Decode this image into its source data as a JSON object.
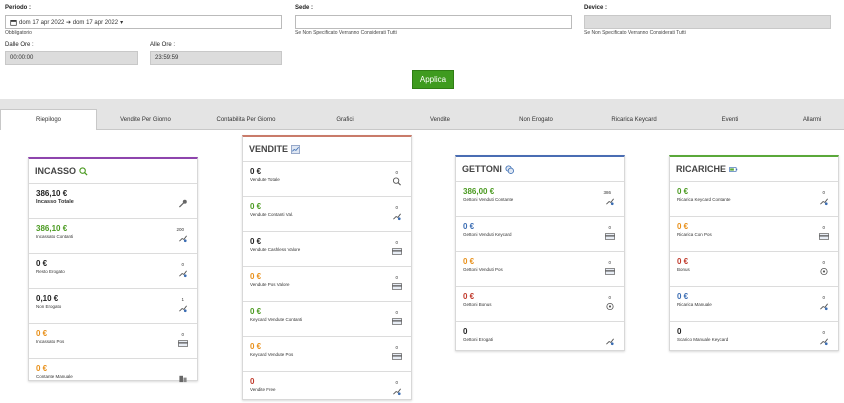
{
  "filters": {
    "period_label": "Periodo :",
    "period_value": "dom 17 apr 2022 ➔ dom 17 apr 2022",
    "period_required": "Obbligatorio",
    "sede_label": "Sede :",
    "sede_hint": "Se Non Specificato Verranno Considerati Tutti",
    "device_label": "Device :",
    "device_hint": "Se Non Specificato Verranno Considerati Tutti",
    "from_label": "Dalle Ore :",
    "from_value": "00:00:00",
    "to_label": "Alle Ore :",
    "to_value": "23:59:59",
    "apply_label": "Applica"
  },
  "tabs": [
    "Riepilogo",
    "Vendite Per Giorno",
    "Contabilita Per Giorno",
    "Grafici",
    "Vendite",
    "Non Erogato",
    "Ricarica Keycard",
    "Eventi",
    "Allarmi"
  ],
  "colors": {
    "green": "#4a9a20",
    "orange": "#e8901a",
    "red": "#c0392b",
    "blue": "#3b6db3",
    "dark": "#222222",
    "accent_incasso": "#8e44ad",
    "accent_vendite": "#c97b6a",
    "accent_gettoni": "#4a6db3",
    "accent_ricariche": "#5aa83a"
  },
  "cards": {
    "incasso": {
      "title": "INCASSO",
      "rows": [
        {
          "value": "386,10 €",
          "label": "Incasso Totale",
          "count": ""
        },
        {
          "value": "386,10 €",
          "label": "Incassato Contanti",
          "count": "200"
        },
        {
          "value": "0 €",
          "label": "Resto Erogato",
          "count": "0"
        },
        {
          "value": "0,10 €",
          "label": "Non Erogato",
          "count": "1"
        },
        {
          "value": "0 €",
          "label": "Incassato Pos",
          "count": "0"
        },
        {
          "value": "0 €",
          "label": "Contante Manuale",
          "count": ""
        }
      ]
    },
    "vendite": {
      "title": "VENDITE",
      "rows": [
        {
          "value": "0 €",
          "label": "Vendute Totale",
          "count": "0"
        },
        {
          "value": "0 €",
          "label": "Vendute Contanti Val.",
          "count": "0"
        },
        {
          "value": "0 €",
          "label": "Vendute Cashless Valore",
          "count": "0"
        },
        {
          "value": "0 €",
          "label": "Vendute Pos Valore",
          "count": "0"
        },
        {
          "value": "0 €",
          "label": "Keycard Vendute Contanti",
          "count": "0"
        },
        {
          "value": "0 €",
          "label": "Keycard Vendute Pos",
          "count": "0"
        },
        {
          "value": "0",
          "label": "Vendite Free",
          "count": "0"
        }
      ]
    },
    "gettoni": {
      "title": "GETTONI",
      "rows": [
        {
          "value": "386,00 €",
          "label": "Gettoni Venduti Contante",
          "count": "386"
        },
        {
          "value": "0 €",
          "label": "Gettoni Venduti Keycard",
          "count": "0"
        },
        {
          "value": "0 €",
          "label": "Gettoni Venduti Pos",
          "count": "0"
        },
        {
          "value": "0 €",
          "label": "Gettoni Bonus",
          "count": "0"
        },
        {
          "value": "0",
          "label": "Gettoni Erogati",
          "count": ""
        }
      ]
    },
    "ricariche": {
      "title": "RICARICHE",
      "rows": [
        {
          "value": "0 €",
          "label": "Ricarica Keycard Contante",
          "count": "0"
        },
        {
          "value": "0 €",
          "label": "Ricarica Con Pos",
          "count": "0"
        },
        {
          "value": "0 €",
          "label": "Bonus",
          "count": "0"
        },
        {
          "value": "0 €",
          "label": "Ricarica Manuale",
          "count": "0"
        },
        {
          "value": "0",
          "label": "Scarico Manuale Keycard",
          "count": "0"
        }
      ]
    }
  }
}
